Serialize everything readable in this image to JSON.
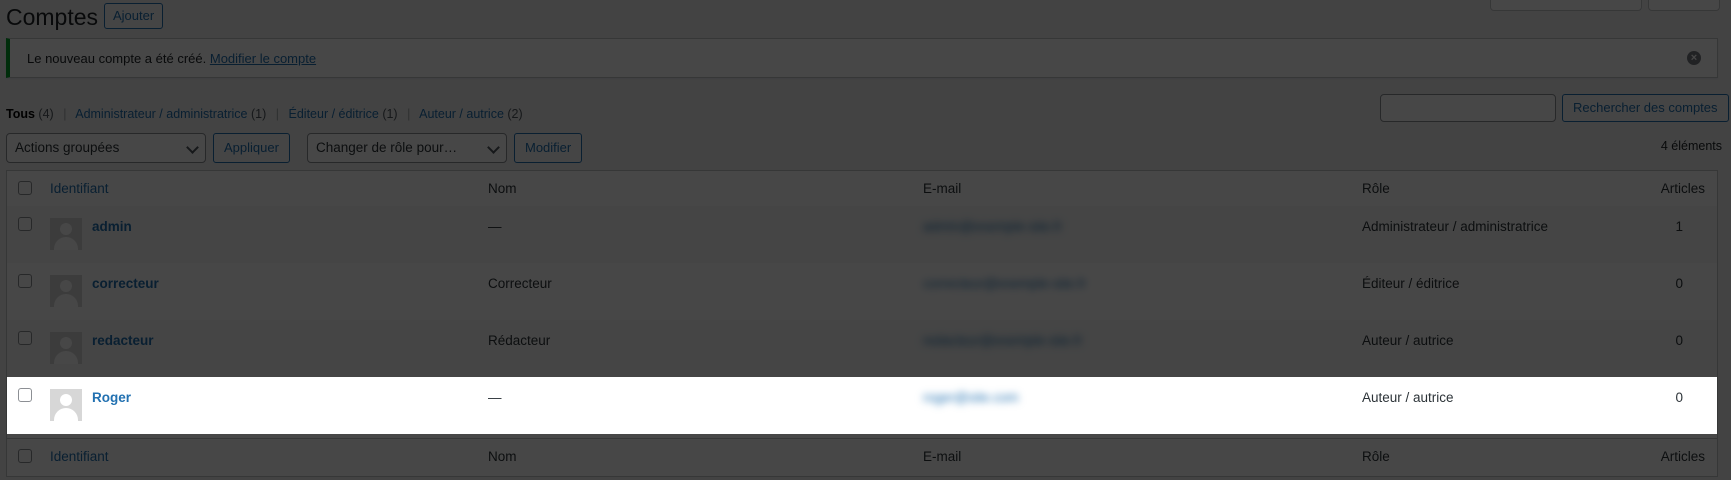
{
  "header": {
    "title": "Comptes",
    "add_label": "Ajouter"
  },
  "notice": {
    "text": "Le nouveau compte a été créé.",
    "link": "Modifier le compte",
    "dismiss_icon": "dismiss-icon"
  },
  "filters": [
    {
      "label": "Tous",
      "count": "(4)"
    },
    {
      "label": "Administrateur / administratrice",
      "count": "(1)"
    },
    {
      "label": "Éditeur / éditrice",
      "count": "(1)"
    },
    {
      "label": "Auteur / autrice",
      "count": "(2)"
    }
  ],
  "search": {
    "button": "Rechercher des comptes",
    "value": ""
  },
  "bulk": {
    "actions_label": "Actions groupées",
    "apply_label": "Appliquer",
    "role_label": "Changer de rôle pour…",
    "modify_label": "Modifier"
  },
  "items_count": "4 éléments",
  "columns": {
    "username": "Identifiant",
    "name": "Nom",
    "email": "E-mail",
    "role": "Rôle",
    "posts": "Articles"
  },
  "rows": [
    {
      "username": "admin",
      "name": "—",
      "email": "admin@exemple-site.fr",
      "role": "Administrateur / administratrice",
      "posts": "1"
    },
    {
      "username": "correcteur",
      "name": "Correcteur",
      "email": "correcteur@exemple-site.fr",
      "role": "Éditeur / éditrice",
      "posts": "0"
    },
    {
      "username": "redacteur",
      "name": "Rédacteur",
      "email": "redacteur@exemple-site.fr",
      "role": "Auteur / autrice",
      "posts": "0"
    },
    {
      "username": "Roger",
      "name": "—",
      "email": "roger@site.com",
      "role": "Auteur / autrice",
      "posts": "0"
    }
  ],
  "colors": {
    "accent": "#2271b1",
    "success_border": "#00a32a",
    "overlay": "rgba(0,0,0,0.72)"
  }
}
